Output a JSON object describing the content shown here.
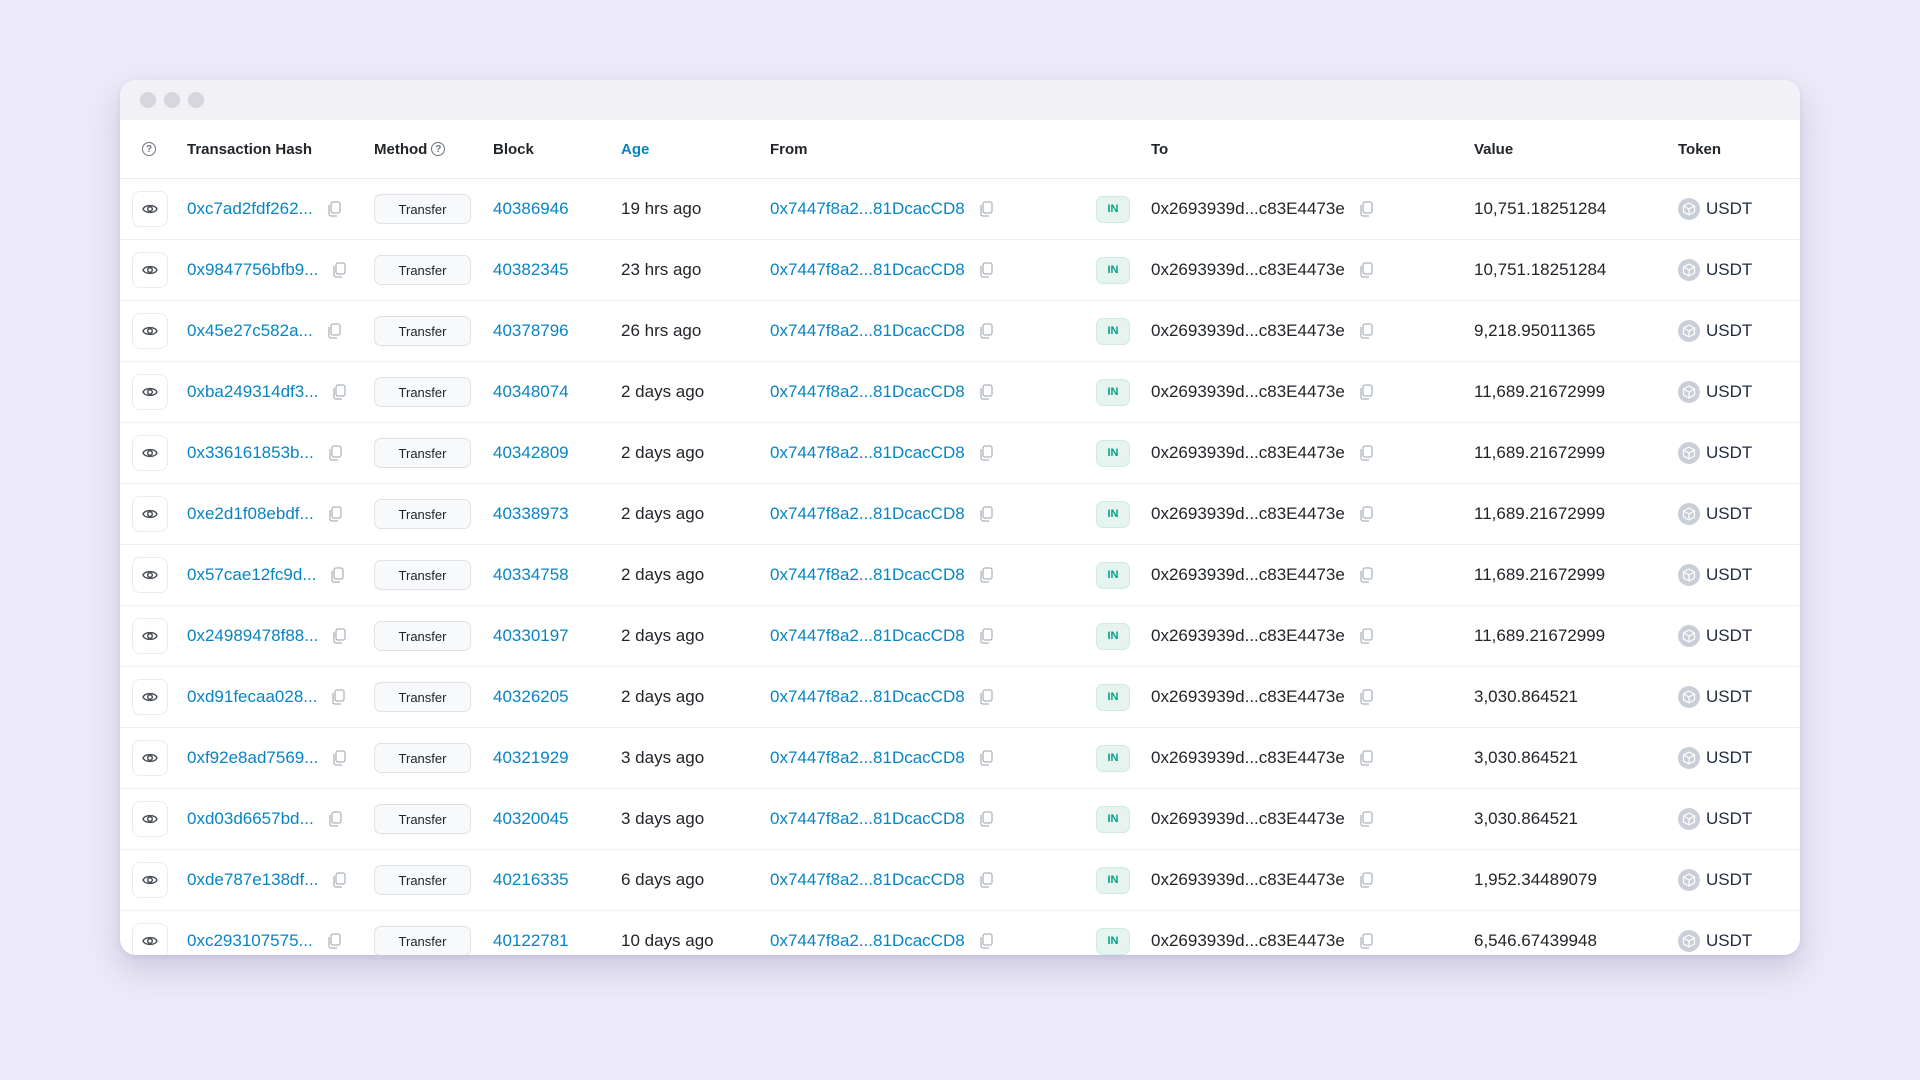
{
  "window": {
    "traffic_lights": [
      "close",
      "minimize",
      "maximize"
    ]
  },
  "table": {
    "headers": {
      "info_icon": "question-circle-icon",
      "hash": "Transaction Hash",
      "method": "Method",
      "block": "Block",
      "age": "Age",
      "from": "From",
      "to": "To",
      "value": "Value",
      "token": "Token"
    },
    "active_header": "Age",
    "rows": [
      {
        "hash": "0xc7ad2fdf262...",
        "method": "Transfer",
        "block": "40386946",
        "age": "19 hrs ago",
        "from": "0x7447f8a2...81DcacCD8",
        "direction": "IN",
        "to": "0x2693939d...c83E4473e",
        "value": "10,751.18251284",
        "token": "USDT"
      },
      {
        "hash": "0x9847756bfb9...",
        "method": "Transfer",
        "block": "40382345",
        "age": "23 hrs ago",
        "from": "0x7447f8a2...81DcacCD8",
        "direction": "IN",
        "to": "0x2693939d...c83E4473e",
        "value": "10,751.18251284",
        "token": "USDT"
      },
      {
        "hash": "0x45e27c582a...",
        "method": "Transfer",
        "block": "40378796",
        "age": "26 hrs ago",
        "from": "0x7447f8a2...81DcacCD8",
        "direction": "IN",
        "to": "0x2693939d...c83E4473e",
        "value": "9,218.95011365",
        "token": "USDT"
      },
      {
        "hash": "0xba249314df3...",
        "method": "Transfer",
        "block": "40348074",
        "age": "2 days ago",
        "from": "0x7447f8a2...81DcacCD8",
        "direction": "IN",
        "to": "0x2693939d...c83E4473e",
        "value": "11,689.21672999",
        "token": "USDT"
      },
      {
        "hash": "0x336161853b...",
        "method": "Transfer",
        "block": "40342809",
        "age": "2 days ago",
        "from": "0x7447f8a2...81DcacCD8",
        "direction": "IN",
        "to": "0x2693939d...c83E4473e",
        "value": "11,689.21672999",
        "token": "USDT"
      },
      {
        "hash": "0xe2d1f08ebdf...",
        "method": "Transfer",
        "block": "40338973",
        "age": "2 days ago",
        "from": "0x7447f8a2...81DcacCD8",
        "direction": "IN",
        "to": "0x2693939d...c83E4473e",
        "value": "11,689.21672999",
        "token": "USDT"
      },
      {
        "hash": "0x57cae12fc9d...",
        "method": "Transfer",
        "block": "40334758",
        "age": "2 days ago",
        "from": "0x7447f8a2...81DcacCD8",
        "direction": "IN",
        "to": "0x2693939d...c83E4473e",
        "value": "11,689.21672999",
        "token": "USDT"
      },
      {
        "hash": "0x24989478f88...",
        "method": "Transfer",
        "block": "40330197",
        "age": "2 days ago",
        "from": "0x7447f8a2...81DcacCD8",
        "direction": "IN",
        "to": "0x2693939d...c83E4473e",
        "value": "11,689.21672999",
        "token": "USDT"
      },
      {
        "hash": "0xd91fecaa028...",
        "method": "Transfer",
        "block": "40326205",
        "age": "2 days ago",
        "from": "0x7447f8a2...81DcacCD8",
        "direction": "IN",
        "to": "0x2693939d...c83E4473e",
        "value": "3,030.864521",
        "token": "USDT"
      },
      {
        "hash": "0xf92e8ad7569...",
        "method": "Transfer",
        "block": "40321929",
        "age": "3 days ago",
        "from": "0x7447f8a2...81DcacCD8",
        "direction": "IN",
        "to": "0x2693939d...c83E4473e",
        "value": "3,030.864521",
        "token": "USDT"
      },
      {
        "hash": "0xd03d6657bd...",
        "method": "Transfer",
        "block": "40320045",
        "age": "3 days ago",
        "from": "0x7447f8a2...81DcacCD8",
        "direction": "IN",
        "to": "0x2693939d...c83E4473e",
        "value": "3,030.864521",
        "token": "USDT"
      },
      {
        "hash": "0xde787e138df...",
        "method": "Transfer",
        "block": "40216335",
        "age": "6 days ago",
        "from": "0x7447f8a2...81DcacCD8",
        "direction": "IN",
        "to": "0x2693939d...c83E4473e",
        "value": "1,952.34489079",
        "token": "USDT"
      },
      {
        "hash": "0xc293107575...",
        "method": "Transfer",
        "block": "40122781",
        "age": "10 days ago",
        "from": "0x7447f8a2...81DcacCD8",
        "direction": "IN",
        "to": "0x2693939d...c83E4473e",
        "value": "6,546.67439948",
        "token": "USDT"
      }
    ]
  },
  "colors": {
    "link": "#0784c3",
    "in_badge_text": "#00a186",
    "in_badge_bg": "#e6f4f0",
    "page_bg": "#ece9f8"
  }
}
